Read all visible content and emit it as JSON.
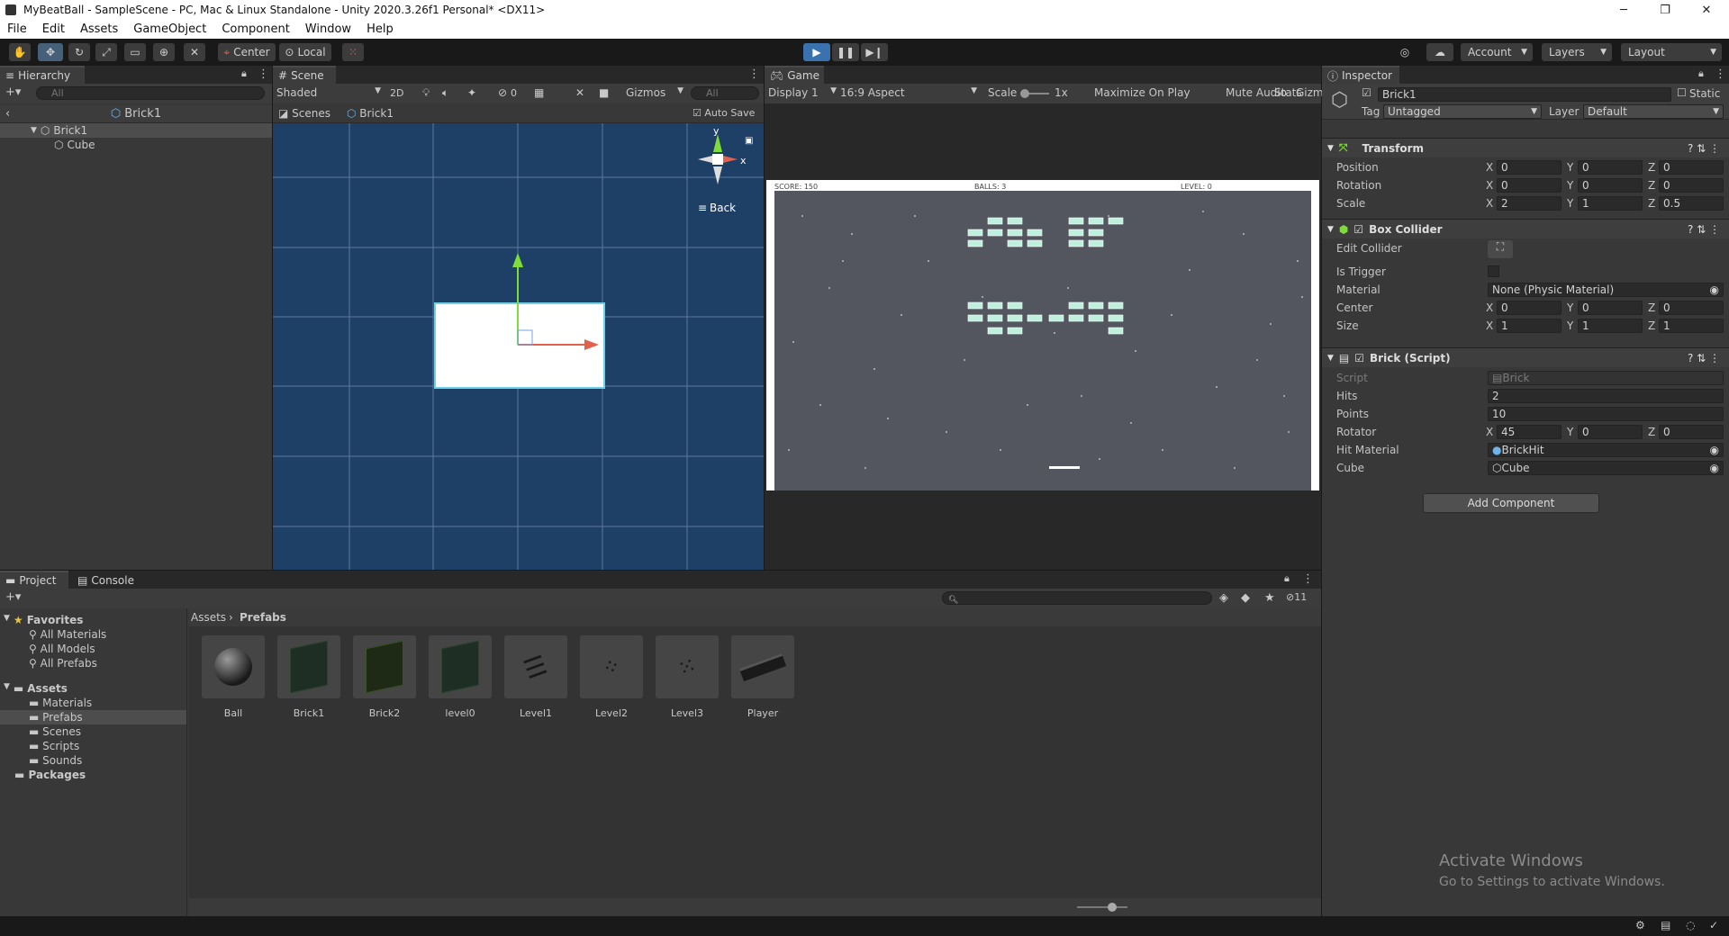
{
  "window": {
    "title": "MyBeatBall - SampleScene - PC, Mac & Linux Standalone - Unity 2020.3.26f1 Personal* <DX11>",
    "minimize": "─",
    "restore": "❐",
    "close": "✕"
  },
  "menu": [
    "File",
    "Edit",
    "Assets",
    "GameObject",
    "Component",
    "Window",
    "Help"
  ],
  "toolbar": {
    "pivot": "Center",
    "space": "Local",
    "account": "Account",
    "layers": "Layers",
    "layout": "Layout",
    "tools": [
      "hand-tool-icon",
      "move-tool-icon",
      "rotate-tool-icon",
      "scale-tool-icon",
      "rect-tool-icon",
      "transform-tool-icon",
      "custom-tool-icon"
    ]
  },
  "hierarchy": {
    "tab": "Hierarchy",
    "add": "+▾",
    "search_placeholder": "All",
    "scene_header": "Brick1",
    "items": [
      "Brick1",
      "Cube"
    ]
  },
  "scene": {
    "tab": "Scene",
    "shading": "Shaded",
    "mode2d": "2D",
    "hidden_count": "0",
    "gizmos": "Gizmos",
    "search_placeholder": "All",
    "breadcrumb_root": "Scenes",
    "breadcrumb_current": "Brick1",
    "auto_save": "Auto Save",
    "gizmo_y": "y",
    "gizmo_x": "x",
    "view_label": "Back",
    "view_menu": "≡"
  },
  "game": {
    "tab": "Game",
    "display": "Display 1",
    "aspect": "16:9 Aspect",
    "scale_label": "Scale",
    "scale_value": "1x",
    "maximize": "Maximize On Play",
    "mute": "Mute Audio",
    "stats": "Stats",
    "gizmos": "Gizm",
    "hud": {
      "score": "SCORE: 150",
      "balls": "BALLS: 3",
      "level": "LEVEL: 0"
    }
  },
  "inspector": {
    "tab": "Inspector",
    "object_name": "Brick1",
    "static_label": "Static",
    "tag_label": "Tag",
    "tag_value": "Untagged",
    "layer_label": "Layer",
    "layer_value": "Default",
    "transform": {
      "title": "Transform",
      "position": {
        "label": "Position",
        "x": "0",
        "y": "0",
        "z": "0"
      },
      "rotation": {
        "label": "Rotation",
        "x": "0",
        "y": "0",
        "z": "0"
      },
      "scale": {
        "label": "Scale",
        "x": "2",
        "y": "1",
        "z": "0.5"
      }
    },
    "box_collider": {
      "title": "Box Collider",
      "edit_collider": "Edit Collider",
      "is_trigger": "Is Trigger",
      "material_label": "Material",
      "material_value": "None (Physic Material)",
      "center": {
        "label": "Center",
        "x": "0",
        "y": "0",
        "z": "0"
      },
      "size": {
        "label": "Size",
        "x": "1",
        "y": "1",
        "z": "1"
      }
    },
    "brick_script": {
      "title": "Brick (Script)",
      "script_label": "Script",
      "script_value": "Brick",
      "hits_label": "Hits",
      "hits_value": "2",
      "points_label": "Points",
      "points_value": "10",
      "rotator": {
        "label": "Rotator",
        "x": "45",
        "y": "0",
        "z": "0"
      },
      "hit_material_label": "Hit Material",
      "hit_material_value": "BrickHit",
      "cube_label": "Cube",
      "cube_value": "Cube"
    },
    "add_component": "Add Component",
    "axis_x": "X",
    "axis_y": "Y",
    "axis_z": "Z"
  },
  "project": {
    "tab_project": "Project",
    "tab_console": "Console",
    "add": "+▾",
    "hidden_count": "11",
    "favorites_label": "Favorites",
    "favorites": [
      "All Materials",
      "All Models",
      "All Prefabs"
    ],
    "assets_label": "Assets",
    "assets_folders": [
      "Materials",
      "Prefabs",
      "Scenes",
      "Scripts",
      "Sounds"
    ],
    "packages_label": "Packages",
    "breadcrumb_root": "Assets",
    "breadcrumb_current": "Prefabs",
    "items": [
      "Ball",
      "Brick1",
      "Brick2",
      "level0",
      "Level1",
      "Level2",
      "Level3",
      "Player"
    ]
  },
  "watermark": {
    "line1": "Activate Windows",
    "line2": "Go to Settings to activate Windows."
  },
  "colors": {
    "scene_bg": "#1e3f66",
    "game_bg": "#53565e",
    "brick": "#bff0de",
    "accent_blue": "#2c5d87",
    "play_active": "#3a72b0"
  }
}
